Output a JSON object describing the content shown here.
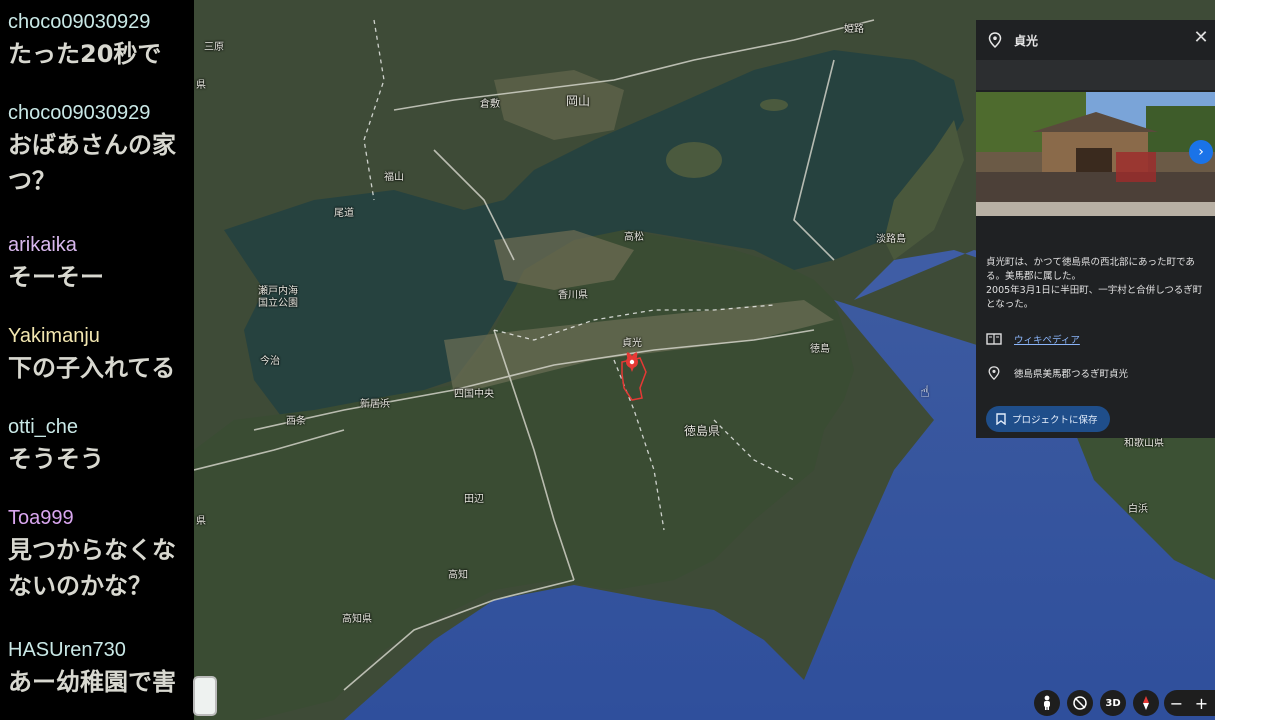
{
  "chat": {
    "messages": [
      {
        "user": "choco09030929",
        "user_color": "#c9e8e6",
        "lines": [
          "たった20秒で"
        ]
      },
      {
        "user": "choco09030929",
        "user_color": "#c9e8e6",
        "lines": [
          "おばあさんの家",
          "つ？"
        ]
      },
      {
        "user": "arikaika",
        "user_color": "#d9b8ee",
        "lines": [
          "そーそー"
        ]
      },
      {
        "user": "Yakimanju",
        "user_color": "#f2e6b0",
        "lines": [
          "下の子入れてる"
        ]
      },
      {
        "user": "otti_che",
        "user_color": "#c9e8e6",
        "lines": [
          "そうそう"
        ]
      },
      {
        "user": "Toa999",
        "user_color": "#d9a6ef",
        "lines": [
          "見つからなくな",
          "ないのかな？"
        ]
      },
      {
        "user": "HASUren730",
        "user_color": "#c9e8e6",
        "lines": [
          "あー幼稚園で害"
        ]
      }
    ]
  },
  "map": {
    "labels": {
      "okayama": "岡山",
      "fukuyama": "福山",
      "kurashiki": "倉敷",
      "onomichi": "尾道",
      "takamatsu": "高松",
      "kagawa": "香川県",
      "awaji": "淡路島",
      "setonaikai": "瀬戸内海",
      "kokuritsu": "国立公園",
      "imabari": "今治",
      "niihama": "新居浜",
      "saijo": "西条",
      "shikokuchuo": "四国中央",
      "sadamitsu_map": "貞光",
      "tokushima_pref": "徳島県",
      "tokushima": "徳島",
      "kochi": "高知",
      "kochi_pref": "高知県",
      "wakayama_pref": "和歌山県",
      "shirahama": "白浜",
      "himeji": "姫路",
      "ken_left": "県",
      "ken_left2": "県",
      "mishima": "三原",
      "tanabe": "田辺"
    },
    "marker_color": "#e53935"
  },
  "panel": {
    "title": "貞光",
    "description": [
      "貞光町は、かつて徳島県の西北部にあった町であ",
      "る。美馬郡に属した。",
      "2005年3月1日に半田町、一宇村と合併しつるぎ町",
      "となった。"
    ],
    "wiki_label": "ウィキペディア",
    "address": "徳島県美馬郡つるぎ町貞光",
    "save_label": "プロジェクトに保存",
    "icons": {
      "pin": "location-pin-icon",
      "close": "close-icon",
      "next": "chevron-right-icon",
      "book": "wikipedia-icon",
      "bookmark": "bookmark-icon"
    }
  },
  "controls": {
    "view_3d": "3D",
    "zoom_out": "−",
    "zoom_in": "+"
  }
}
